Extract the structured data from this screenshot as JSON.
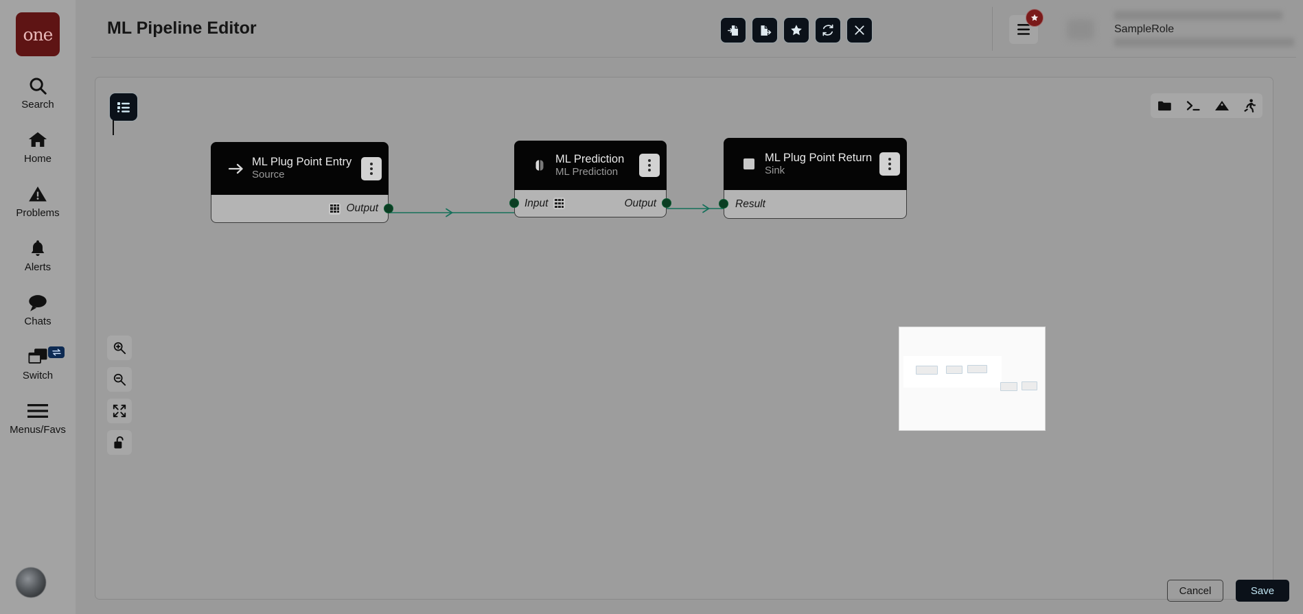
{
  "sidebar": {
    "logo_text": "one",
    "items": [
      {
        "label": "Search",
        "icon": "search-icon"
      },
      {
        "label": "Home",
        "icon": "home-icon"
      },
      {
        "label": "Problems",
        "icon": "warning-triangle-icon"
      },
      {
        "label": "Alerts",
        "icon": "bell-icon"
      },
      {
        "label": "Chats",
        "icon": "chat-bubble-icon"
      },
      {
        "label": "Switch",
        "icon": "windows-switch-icon"
      },
      {
        "label": "Menus/Favs",
        "icon": "hamburger-icon"
      }
    ],
    "avatar_icon": "user-avatar-icon"
  },
  "header": {
    "title": "ML Pipeline Editor",
    "actions": [
      {
        "name": "import-button",
        "icon": "document-import-icon"
      },
      {
        "name": "export-button",
        "icon": "document-export-icon"
      },
      {
        "name": "favorite-button",
        "icon": "star-icon"
      },
      {
        "name": "refresh-button",
        "icon": "refresh-icon"
      },
      {
        "name": "close-button",
        "icon": "close-x-icon"
      }
    ],
    "menu_icon": "hamburger-menu-icon",
    "menu_badge_icon": "star-badge-icon",
    "menu_badge_color": "#7a1a1a",
    "role": {
      "value": "SampleRole",
      "chevron_icon": "chevron-down-icon"
    }
  },
  "canvas": {
    "palette_icon": "list-palette-icon",
    "tools": [
      {
        "name": "open-folder-tool",
        "icon": "folder-icon"
      },
      {
        "name": "console-tool",
        "icon": "terminal-icon"
      },
      {
        "name": "image-tool",
        "icon": "mountain-image-icon"
      },
      {
        "name": "run-tool",
        "icon": "runner-icon"
      }
    ],
    "zoom_controls": [
      {
        "name": "zoom-in-button",
        "icon": "magnifier-plus-icon"
      },
      {
        "name": "zoom-out-button",
        "icon": "magnifier-minus-icon"
      },
      {
        "name": "fit-to-screen-button",
        "icon": "collapse-arrows-icon"
      },
      {
        "name": "lock-button",
        "icon": "open-padlock-icon"
      }
    ],
    "edge_color": "#14705a",
    "port_color": "#0a3d22"
  },
  "pipeline": {
    "nodes": [
      {
        "title": "ML Plug Point Entry",
        "subtitle": "Source",
        "icon": "arrow-right-icon",
        "ports": [
          {
            "label": "Output",
            "side": "right",
            "has_grid_icon": true
          }
        ]
      },
      {
        "title": "ML Prediction",
        "subtitle": "ML Prediction",
        "icon": "brain-icon",
        "ports": [
          {
            "label": "Input",
            "side": "left",
            "has_grid_icon": true
          },
          {
            "label": "Output",
            "side": "right",
            "has_grid_icon": false
          }
        ]
      },
      {
        "title": "ML Plug Point Return",
        "subtitle": "Sink",
        "icon": "square-icon",
        "ports": [
          {
            "label": "Result",
            "side": "left",
            "has_grid_icon": false
          }
        ]
      }
    ]
  },
  "footer": {
    "cancel_label": "Cancel",
    "save_label": "Save"
  }
}
